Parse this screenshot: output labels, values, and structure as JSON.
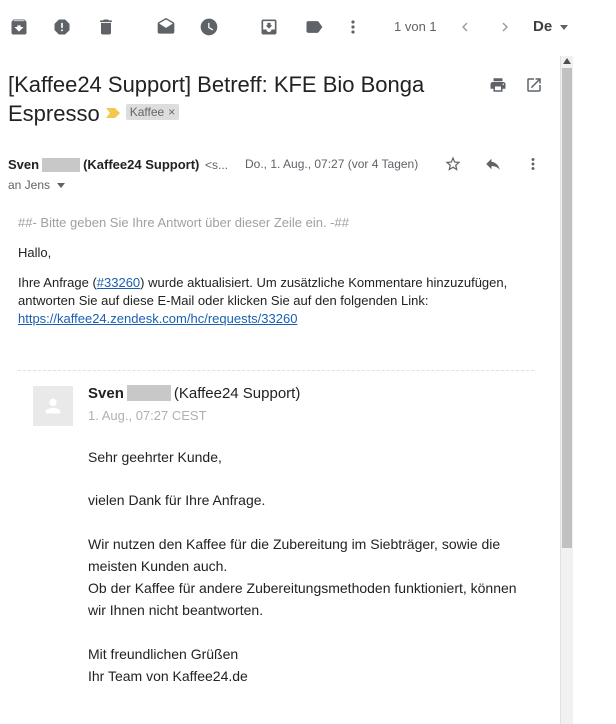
{
  "toolbar": {
    "icons": [
      "archive-icon",
      "report-spam-icon",
      "delete-icon",
      "mark-unread-icon",
      "snooze-icon",
      "move-to-inbox-icon",
      "label-icon",
      "more-vert-icon"
    ],
    "pager": "1 von 1",
    "language": "De"
  },
  "subject": {
    "title": "[Kaffee24 Support] Betreff: KFE Bio Bonga Espresso",
    "label": "Kaffee",
    "label_close": "×"
  },
  "sender": {
    "first_name": "Sven",
    "org": "(Kaffee24 Support)",
    "email_truncated": "<s...",
    "date": "Do., 1. Aug., 07:27 (vor 4 Tagen)",
    "recipient": "an Jens"
  },
  "message": {
    "reply_marker": "##- Bitte geben Sie Ihre Antwort über dieser Zeile ein. -##",
    "greeting": "Hallo,",
    "intro_before_link": "Ihre Anfrage (",
    "ticket_link": "#33260",
    "intro_after_link": ") wurde aktualisiert. Um zusätzliche Kommentare hinzuzufügen, antworten Sie auf diese E-Mail oder klicken Sie auf den folgenden Link:",
    "url": "https://kaffee24.zendesk.com/hc/requests/33260"
  },
  "quoted": {
    "first_name": "Sven",
    "org": "(Kaffee24 Support)",
    "date": "1. Aug., 07:27 CEST",
    "salutation": "Sehr geehrter Kunde,",
    "thanks": "vielen Dank für Ihre Anfrage.",
    "line1": "Wir nutzen den Kaffee für die Zubereitung im Siebträger, sowie die meisten Kunden auch.",
    "line2": "Ob der Kaffee für andere Zubereitungsmethoden funktioniert, können wir Ihnen nicht beantworten.",
    "closing": "Mit freundlichen Grüßen",
    "signature": "Ihr Team von Kaffee24.de"
  },
  "colors": {
    "link": "#1a5fb4",
    "important_marker": "#f2c94c",
    "muted": "#5f6368"
  }
}
